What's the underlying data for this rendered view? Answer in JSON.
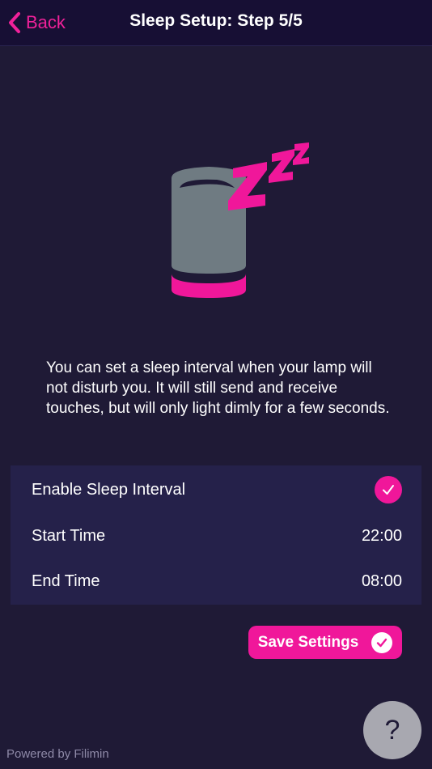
{
  "header": {
    "back_label": "Back",
    "title": "Sleep Setup: Step 5/5"
  },
  "illustration": {
    "icon": "sleeping-lamp-icon",
    "colors": {
      "lamp": "#6f7b82",
      "base": "#f0179a",
      "zzz": "#f0179a"
    }
  },
  "description": "You can set a sleep interval when your lamp will not disturb you. It will still send and receive touches, but will only light dimly for a few seconds.",
  "settings": {
    "enable_label": "Enable Sleep Interval",
    "enabled": true,
    "start_label": "Start Time",
    "start_value": "22:00",
    "end_label": "End Time",
    "end_value": "08:00"
  },
  "save_label": "Save Settings",
  "footer": {
    "powered_by": "Powered by Filimin",
    "help_label": "?"
  },
  "colors": {
    "background": "#1f1a36",
    "topbar": "#170f34",
    "panel": "#25214a",
    "accent": "#f0179a"
  }
}
